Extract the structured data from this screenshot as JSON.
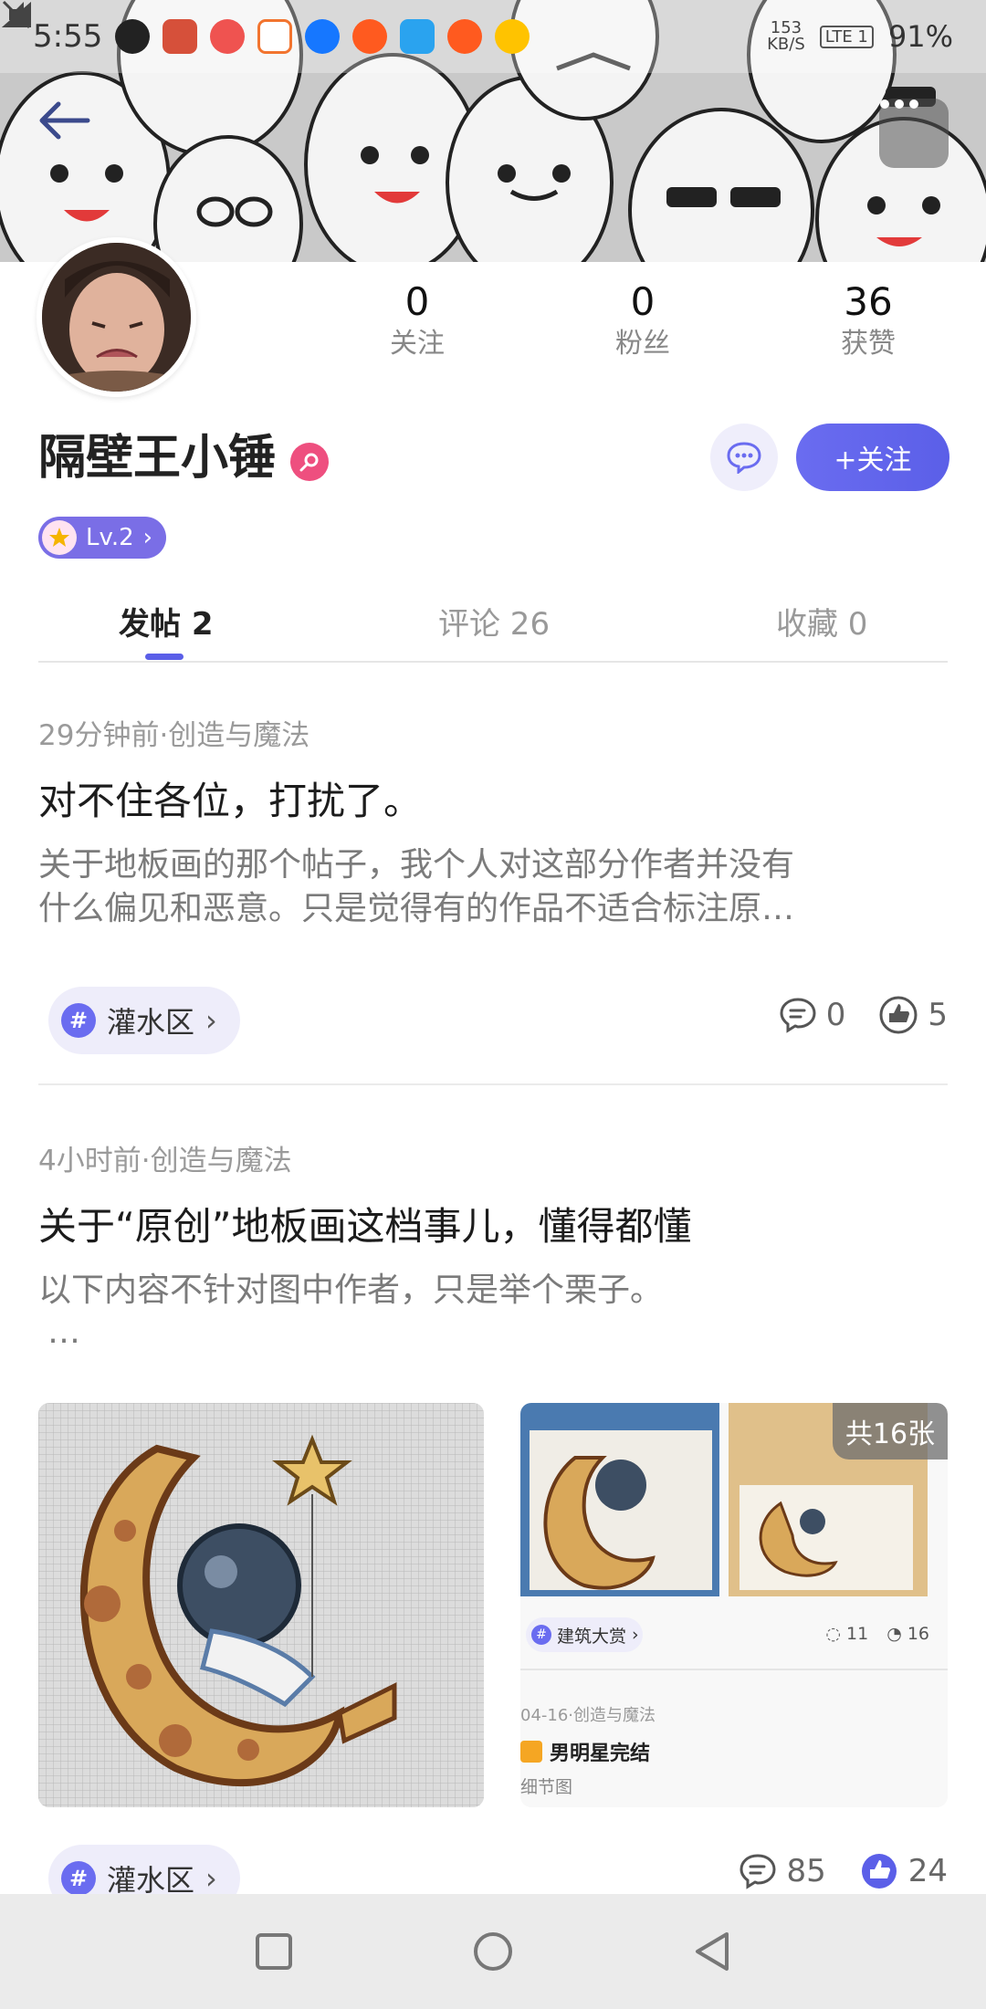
{
  "status_bar": {
    "time": "5:55",
    "net_speed_value": "153",
    "net_speed_unit": "KB/S",
    "network": "LTE 1",
    "battery": "91%"
  },
  "header": {
    "back_icon": "arrow-left-icon",
    "more_icon": "more-dots-icon"
  },
  "profile": {
    "username": "隔壁王小锤",
    "level": "Lv.2",
    "follow_button": "+关注",
    "stats": [
      {
        "value": "0",
        "label": "关注"
      },
      {
        "value": "0",
        "label": "粉丝"
      },
      {
        "value": "36",
        "label": "获赞"
      }
    ]
  },
  "tabs": [
    {
      "label": "发帖 2",
      "active": true
    },
    {
      "label": "评论 26",
      "active": false
    },
    {
      "label": "收藏 0",
      "active": false
    }
  ],
  "posts": [
    {
      "meta": "29分钟前·创造与魔法",
      "title": "对不住各位，打扰了。",
      "excerpt_line1": "关于地板画的那个帖子，我个人对这部分作者并没有",
      "excerpt_line2": "什么偏见和恶意。只是觉得有的作品不适合标注原…",
      "topic": "灌水区",
      "comments": "0",
      "likes": "5"
    },
    {
      "meta": "4小时前·创造与魔法",
      "title": "关于“原创”地板画这档事儿，懂得都懂",
      "excerpt_line1": "以下内容不针对图中作者，只是举个栗子。",
      "excerpt_line2": "…",
      "image_count": "共16张",
      "inner_card": {
        "tag": "建筑大赏",
        "comments": "11",
        "likes": "16",
        "meta": "04-16·创造与魔法",
        "title": "男明星完结",
        "subtitle": "细节图"
      },
      "topic": "灌水区",
      "comments": "85",
      "likes": "24"
    }
  ],
  "colors": {
    "accent": "#5b5fe8",
    "chip_bg": "#eeedfa",
    "badge_pink": "#ee4f7f"
  }
}
